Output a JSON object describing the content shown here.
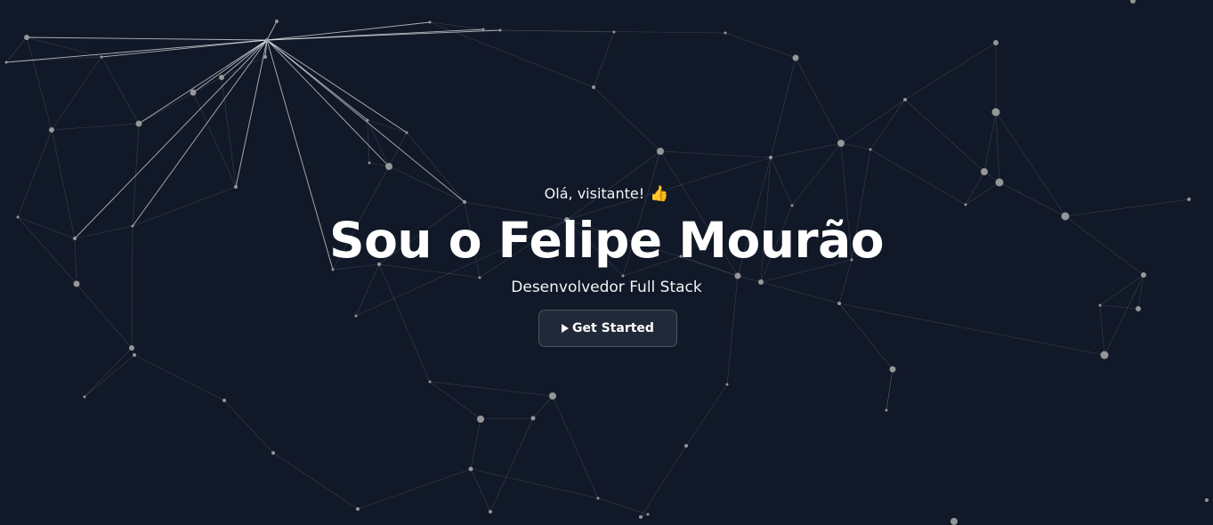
{
  "hero": {
    "greeting": "Olá, visitante!",
    "greeting_icon": "👍",
    "title": "Sou o Felipe Mourão",
    "subtitle": "Desenvolvedor Full Stack",
    "cta_label": "Get Started",
    "cta_icon": "play-icon"
  },
  "colors": {
    "background": "#111827",
    "node": "#a3a3a3",
    "link": "#9ca3af",
    "button_bg": "#1f2937",
    "button_border": "#4b5563",
    "text": "#ffffff"
  }
}
